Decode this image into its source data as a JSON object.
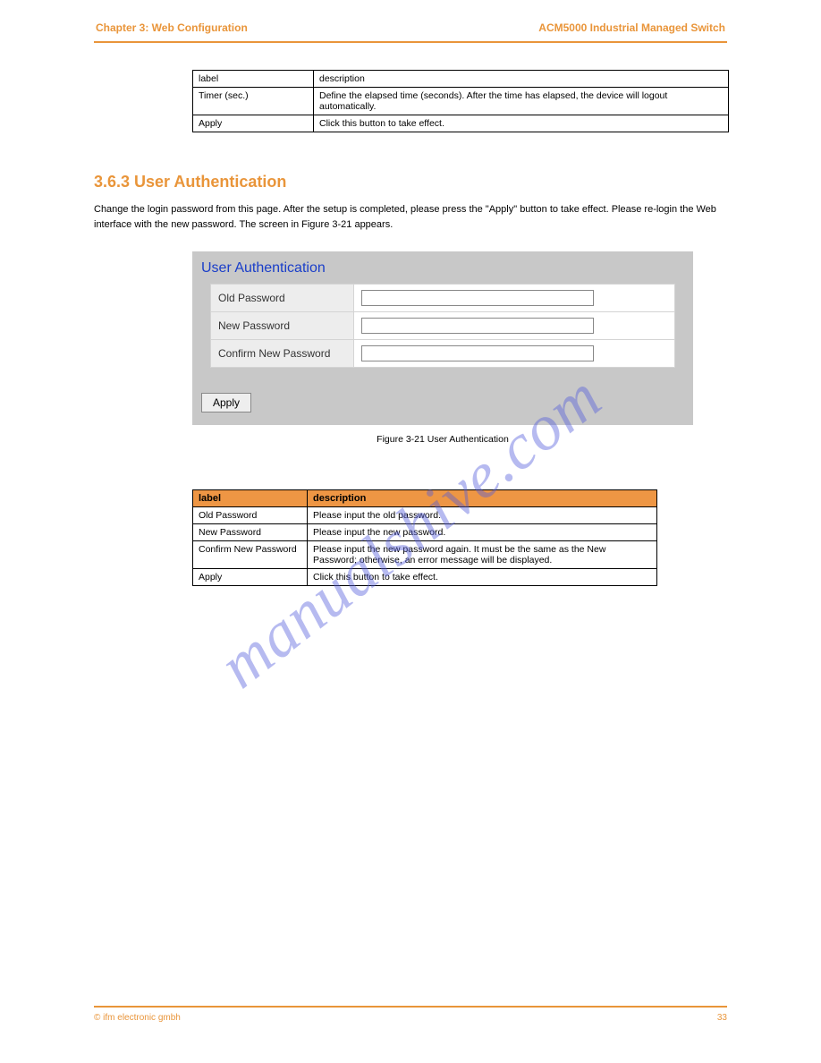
{
  "header": {
    "left": "Chapter 3: Web Configuration",
    "right": "ACM5000 Industrial Managed Switch"
  },
  "table1": {
    "rows": [
      {
        "c1": "label",
        "c2": "description"
      },
      {
        "c1": "Timer (sec.)",
        "c2": "Define the elapsed time (seconds). After the time has elapsed, the device will logout automatically."
      },
      {
        "c1": "Apply",
        "c2": "Click this button to take effect."
      }
    ]
  },
  "section": {
    "title": "3.6.3 User Authentication",
    "body": "Change the login password from this page. After the setup is completed, please press the \"Apply\" button to take effect. Please re-login the Web interface with the new password. The screen in Figure 3-21 appears."
  },
  "ua_panel": {
    "title": "User Authentication",
    "old_pw_label": "Old Password",
    "new_pw_label": "New Password",
    "confirm_pw_label": "Confirm New Password",
    "apply_label": "Apply"
  },
  "figure_caption": "Figure 3-21 User Authentication",
  "table2": {
    "head": {
      "c1": "label",
      "c2": "description"
    },
    "rows": [
      {
        "c1": "Old Password",
        "c2": "Please input the old password."
      },
      {
        "c1": "New Password",
        "c2": "Please input the new password."
      },
      {
        "c1": "Confirm New Password",
        "c2": "Please input the new password again. It must be the same as the New Password; otherwise, an error message will be displayed."
      },
      {
        "c1": "Apply",
        "c2": "Click this button to take effect."
      }
    ]
  },
  "footer": {
    "left": "© ifm electronic gmbh",
    "right": "33"
  },
  "watermark": "manualshive.com"
}
